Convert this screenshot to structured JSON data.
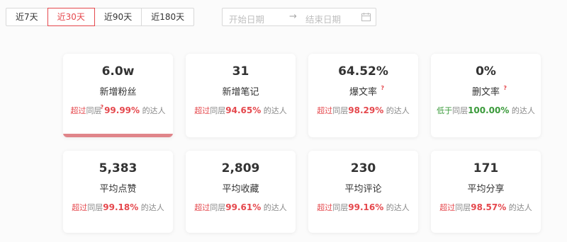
{
  "ranges": [
    "近7天",
    "近30天",
    "近90天",
    "近180天"
  ],
  "active_range": "近30天",
  "date_range": {
    "start_placeholder": "开始日期",
    "separator": "→",
    "end_placeholder": "结束日期"
  },
  "colors": {
    "accent": "#e5484d",
    "positive_text": "#e5484d",
    "negative_text": "#3a9a3a",
    "active_bar": "#e0858a"
  },
  "metrics": [
    {
      "value": "6.0w",
      "label": "新增粉丝",
      "has_help": false,
      "compare_word": "超过",
      "compare_text": "同层",
      "compare_help": true,
      "pct": "99.99%",
      "suffix": "的达人",
      "direction": "up",
      "selected": true
    },
    {
      "value": "31",
      "label": "新增笔记",
      "has_help": false,
      "compare_word": "超过",
      "compare_text": "同层",
      "compare_help": false,
      "pct": "94.65%",
      "suffix": "的达人",
      "direction": "up",
      "selected": false
    },
    {
      "value": "64.52%",
      "label": "爆文率",
      "has_help": true,
      "compare_word": "超过",
      "compare_text": "同层",
      "compare_help": false,
      "pct": "98.29%",
      "suffix": "的达人",
      "direction": "up",
      "selected": false
    },
    {
      "value": "0%",
      "label": "删文率",
      "has_help": true,
      "compare_word": "低于",
      "compare_text": "同层",
      "compare_help": false,
      "pct": "100.00%",
      "suffix": "的达人",
      "direction": "down",
      "selected": false
    },
    {
      "value": "5,383",
      "label": "平均点赞",
      "has_help": false,
      "compare_word": "超过",
      "compare_text": "同层",
      "compare_help": false,
      "pct": "99.18%",
      "suffix": "的达人",
      "direction": "up",
      "selected": false
    },
    {
      "value": "2,809",
      "label": "平均收藏",
      "has_help": false,
      "compare_word": "超过",
      "compare_text": "同层",
      "compare_help": false,
      "pct": "99.61%",
      "suffix": "的达人",
      "direction": "up",
      "selected": false
    },
    {
      "value": "230",
      "label": "平均评论",
      "has_help": false,
      "compare_word": "超过",
      "compare_text": "同层",
      "compare_help": false,
      "pct": "99.16%",
      "suffix": "的达人",
      "direction": "up",
      "selected": false
    },
    {
      "value": "171",
      "label": "平均分享",
      "has_help": false,
      "compare_word": "超过",
      "compare_text": "同层",
      "compare_help": false,
      "pct": "98.57%",
      "suffix": "的达人",
      "direction": "up",
      "selected": false
    }
  ],
  "help_glyph": "?"
}
